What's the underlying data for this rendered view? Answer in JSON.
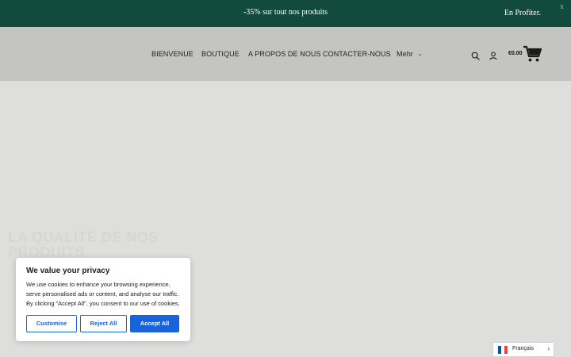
{
  "promo": {
    "text": "-35% sur tout nos produits",
    "cta": "En Profiter.",
    "close": "x"
  },
  "nav": {
    "items": [
      {
        "label": "BIENVENUE"
      },
      {
        "label": "BOUTIQUE"
      },
      {
        "label": "A PROPOS DE NOUS"
      },
      {
        "label": "CONTACTER-NOUS"
      },
      {
        "label": "Mehr"
      }
    ],
    "cart_total": "€0.00"
  },
  "hero": {
    "heading": "LA QUALITÉ DE NOS PRODUITS"
  },
  "cookie": {
    "title": "We value your privacy",
    "text": "We use cookies to enhance your browsing experience, serve personalised ads or content, and analyse our traffic. By clicking \"Accept All\", you consent to our use of cookies.",
    "customise": "Customise",
    "reject": "Reject All",
    "accept": "Accept All"
  },
  "language": {
    "label": "Français"
  },
  "colors": {
    "promo_bg": "#124b3d",
    "header_bg": "#c4c4c2",
    "cookie_accent": "#1863dc",
    "page_bg": "#dededc"
  },
  "icons": [
    "search-icon",
    "user-icon",
    "cart-icon",
    "chevron-down-icon",
    "close-icon",
    "flag-france-icon",
    "chevron-right-icon"
  ]
}
